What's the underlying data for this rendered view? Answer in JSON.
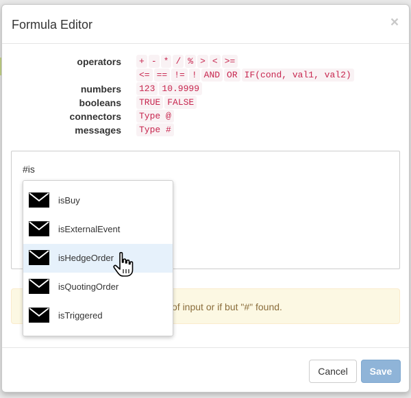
{
  "modal": {
    "title": "Formula Editor",
    "close_symbol": "×"
  },
  "legend": [
    {
      "label": "operators",
      "tokens": [
        "+",
        "-",
        "*",
        "/",
        "%",
        ">",
        "<",
        ">="
      ]
    },
    {
      "label": "",
      "tokens": [
        "<=",
        "==",
        "!=",
        "!",
        "AND",
        "OR",
        "IF(cond, val1, val2)"
      ]
    },
    {
      "label": "numbers",
      "tokens": [
        "123",
        "10.9999"
      ]
    },
    {
      "label": "booleans",
      "tokens": [
        "TRUE",
        "FALSE"
      ]
    },
    {
      "label": "connectors",
      "tokens": [
        "Type @"
      ]
    },
    {
      "label": "messages",
      "tokens": [
        "Type #"
      ]
    }
  ],
  "editor": {
    "value": "#is"
  },
  "autocomplete": {
    "items": [
      {
        "label": "isBuy",
        "icon": "envelope-icon"
      },
      {
        "label": "isExternalEvent",
        "icon": "envelope-icon"
      },
      {
        "label": "isHedgeOrder",
        "icon": "envelope-icon",
        "active": true
      },
      {
        "label": "isQuotingOrder",
        "icon": "envelope-icon"
      },
      {
        "label": "isTriggered",
        "icon": "envelope-icon"
      }
    ]
  },
  "alert": {
    "text": "of input or if but \"#\" found."
  },
  "footer": {
    "cancel_label": "Cancel",
    "save_label": "Save"
  },
  "colors": {
    "token_text": "#c7254e",
    "token_bg": "#f9f2f4",
    "alert_bg": "#fcf8e3",
    "alert_text": "#8a6d3b",
    "save_bg": "#8fb4d8",
    "active_item_bg": "#e6f1fb"
  }
}
